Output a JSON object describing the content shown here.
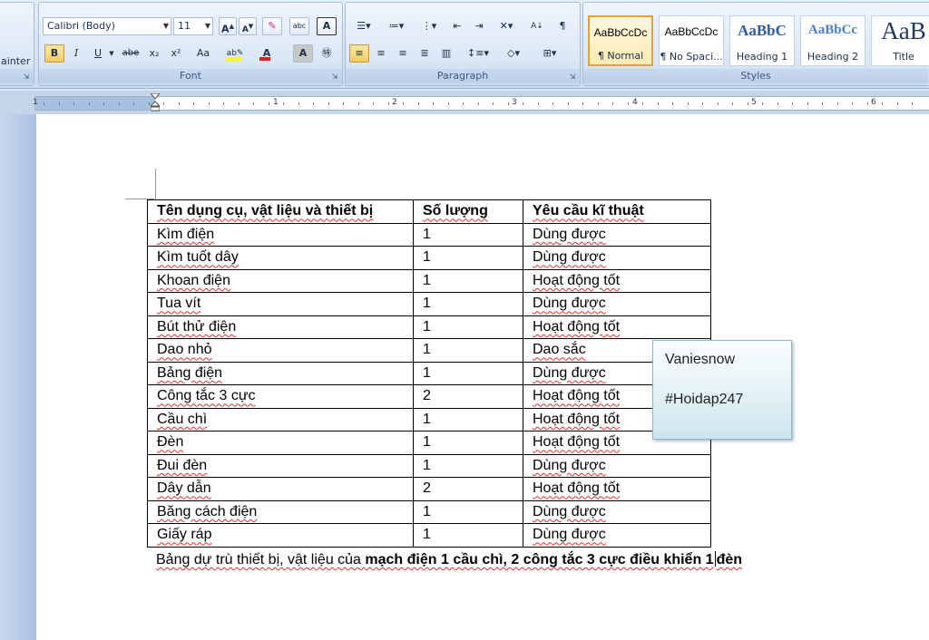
{
  "ribbon": {
    "painter_label": "ainter",
    "font_group": {
      "label": "Font",
      "font_name": "Calibri (Body)",
      "font_size": "11",
      "bold": "B",
      "italic": "I",
      "underline": "U",
      "strike": "abe",
      "subscript": "x₂",
      "superscript": "x²",
      "change_case": "Aa"
    },
    "paragraph_group": {
      "label": "Paragraph"
    },
    "styles_group": {
      "label": "Styles",
      "tiles": [
        {
          "preview": "AaBbCcDc",
          "name": "¶ Normal",
          "selected": true
        },
        {
          "preview": "AaBbCcDc",
          "name": "¶ No Spaci...",
          "selected": false
        },
        {
          "preview": "AaBbC",
          "name": "Heading 1",
          "selected": false
        },
        {
          "preview": "AaBbCc",
          "name": "Heading 2",
          "selected": false
        },
        {
          "preview": "AaB",
          "name": "Title",
          "selected": false
        }
      ]
    },
    "accent_highlight": "#fde9a3",
    "font_color": "#e02020",
    "highlight_color": "#ffff00"
  },
  "ruler": {
    "numbers": [
      "1",
      "1",
      "2",
      "3",
      "4",
      "5",
      "6"
    ]
  },
  "table": {
    "headers": [
      "Tên dụng cụ, vật liệu và thiết bị",
      "Số lượng",
      "Yêu cầu kĩ thuật"
    ],
    "rows": [
      [
        "Kìm điện",
        "1",
        "Dùng được"
      ],
      [
        "Kìm tuốt dây",
        "1",
        "Dùng được"
      ],
      [
        "Khoan điện",
        "1",
        "Hoạt động tốt"
      ],
      [
        "Tua vít",
        "1",
        "Dùng được"
      ],
      [
        "Bút thử điện",
        "1",
        "Hoạt động tốt"
      ],
      [
        "Dao nhỏ",
        "1",
        "Dao sắc"
      ],
      [
        "Bảng điện",
        "1",
        "Dùng được"
      ],
      [
        "Công tắc 3 cực",
        "2",
        "Hoạt động tốt"
      ],
      [
        "Cầu chì",
        "1",
        "Hoạt động tốt"
      ],
      [
        "Đèn",
        "1",
        "Hoạt động tốt"
      ],
      [
        "Đui đèn",
        "1",
        "Dùng được"
      ],
      [
        "Dây dẫn",
        "2",
        "Hoạt động tốt"
      ],
      [
        "Băng cách điện",
        "1",
        "Dùng được"
      ],
      [
        "Giấy ráp",
        "1",
        "Dùng được"
      ]
    ]
  },
  "caption": {
    "normal": "Bảng dự trù thiết bị, vật liệu của ",
    "bold_before_cursor": "mạch điện 1 cầu chì, 2 công tắc 3 cực điều khiển 1",
    "bold_after_cursor": "đèn"
  },
  "note": {
    "line1": "Vaniesnow",
    "line2": "#Hoidap247"
  }
}
